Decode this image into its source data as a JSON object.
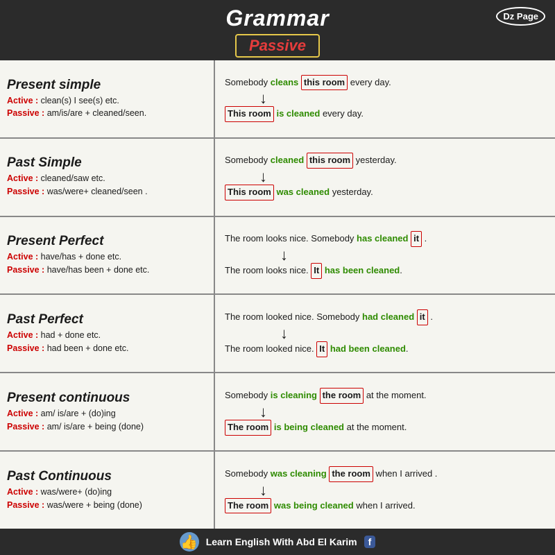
{
  "header": {
    "title": "Grammar",
    "badge_word": "Passive",
    "dz_label": "Dz Page"
  },
  "footer": {
    "text": "Learn English With Abd El Karim",
    "fb": "f"
  },
  "rows": [
    {
      "id": "present-simple",
      "tense": "Present simple",
      "active_label": "Active :",
      "active_rule": "clean(s) I see(s) etc.",
      "passive_label": "Passive :",
      "passive_rule": "am/is/are + cleaned/seen.",
      "ex1_before": "Somebody ",
      "ex1_green": "cleans",
      "ex1_boxed": "this room",
      "ex1_after": " every day.",
      "ex2_boxed": "This room",
      "ex2_green": "is cleaned",
      "ex2_after": " every day."
    },
    {
      "id": "past-simple",
      "tense": "Past Simple",
      "active_label": "Active :",
      "active_rule": "cleaned/saw etc.",
      "passive_label": "Passive :",
      "passive_rule": "was/were+ cleaned/seen .",
      "ex1_before": "Somebody ",
      "ex1_green": "cleaned",
      "ex1_boxed": "this room",
      "ex1_after": " yesterday.",
      "ex2_boxed": "This room",
      "ex2_green": "was cleaned",
      "ex2_after": " yesterday."
    },
    {
      "id": "present-perfect",
      "tense": "Present Perfect",
      "active_label": "Active :",
      "active_rule": "have/has + done etc.",
      "passive_label": "Passive :",
      "passive_rule": "have/has been + done etc.",
      "ex1_before": "The room looks nice. Somebody ",
      "ex1_green": "has cleaned",
      "ex1_boxed": "it",
      "ex1_after": ".",
      "ex2_before": "The room looks nice. ",
      "ex2_boxed": "It",
      "ex2_green": "has been cleaned",
      "ex2_after": "."
    },
    {
      "id": "past-perfect",
      "tense": "Past Perfect",
      "active_label": "Active :",
      "active_rule": "had + done etc.",
      "passive_label": "Passive :",
      "passive_rule": "had been + done etc.",
      "ex1_before": "The room looked nice. Somebody ",
      "ex1_green": "had cleaned",
      "ex1_boxed": "it",
      "ex1_after": ".",
      "ex2_before": "The room looked nice. ",
      "ex2_boxed": "It",
      "ex2_green": "had been cleaned",
      "ex2_after": "."
    },
    {
      "id": "present-continuous",
      "tense": "Present continuous",
      "active_label": "Active :",
      "active_rule": "am/ is/are + (do)ing",
      "passive_label": "Passive :",
      "passive_rule": "am/ is/are + being (done)",
      "ex1_before": "Somebody ",
      "ex1_green": "is cleaning",
      "ex1_boxed": "the room",
      "ex1_after": " at the moment.",
      "ex2_boxed": "The room",
      "ex2_green": "is being cleaned",
      "ex2_after": " at the moment."
    },
    {
      "id": "past-continuous",
      "tense": "Past Continuous",
      "active_label": "Active :",
      "active_rule": "was/were+ (do)ing",
      "passive_label": "Passive :",
      "passive_rule": "was/were + being (done)",
      "ex1_before": "Somebody ",
      "ex1_green": "was cleaning",
      "ex1_boxed": "the room",
      "ex1_after": " when I arrived .",
      "ex2_boxed": "The room",
      "ex2_green": "was being cleaned",
      "ex2_after": " when I arrived."
    }
  ]
}
